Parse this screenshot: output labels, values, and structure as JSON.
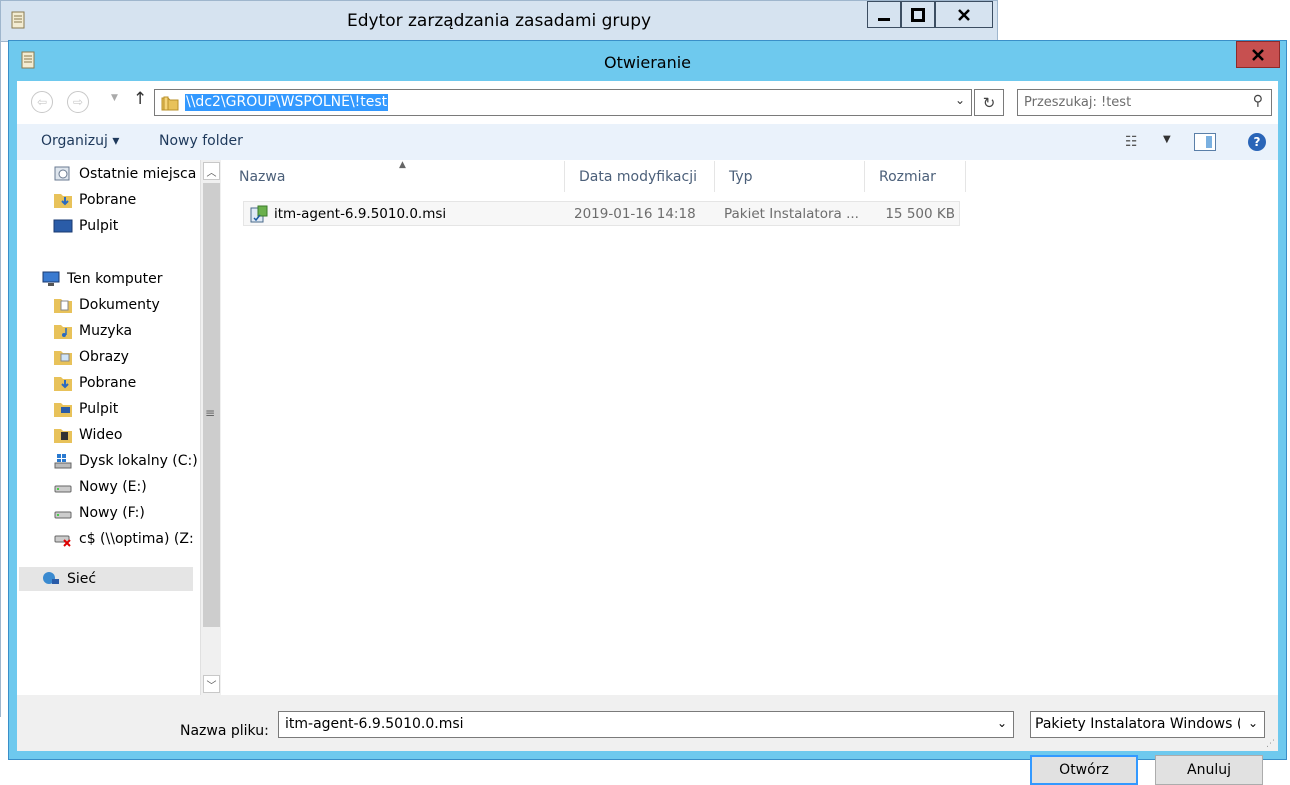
{
  "bg_window": {
    "title": "Edytor zarządzania zasadami grupy",
    "minimize": "▁",
    "maximize": "□",
    "close": "✕"
  },
  "dialog": {
    "title": "Otwieranie",
    "close": "✕"
  },
  "address": {
    "path": "\\\\dc2\\GROUP\\WSPÓLNE\\!test",
    "search_placeholder": "Przeszukaj: !test"
  },
  "toolbar": {
    "organize": "Organizuj ▾",
    "new_folder": "Nowy folder"
  },
  "nav": {
    "items": [
      {
        "label": "Ostatnie miejsca",
        "icon": "recent-places-icon"
      },
      {
        "label": "Pobrane",
        "icon": "downloads-folder-icon"
      },
      {
        "label": "Pulpit",
        "icon": "desktop-icon"
      },
      {
        "label": "Ten komputer",
        "icon": "computer-icon"
      },
      {
        "label": "Dokumenty",
        "icon": "documents-folder-icon"
      },
      {
        "label": "Muzyka",
        "icon": "music-folder-icon"
      },
      {
        "label": "Obrazy",
        "icon": "pictures-folder-icon"
      },
      {
        "label": "Pobrane",
        "icon": "downloads-folder-icon"
      },
      {
        "label": "Pulpit",
        "icon": "desktop-folder-icon"
      },
      {
        "label": "Wideo",
        "icon": "video-folder-icon"
      },
      {
        "label": "Dysk lokalny (C:)",
        "icon": "local-disk-icon"
      },
      {
        "label": "Nowy (E:)",
        "icon": "drive-icon"
      },
      {
        "label": "Nowy (F:)",
        "icon": "drive-icon"
      },
      {
        "label": "c$ (\\\\optima) (Z:",
        "icon": "disconnected-network-drive-icon"
      },
      {
        "label": "Sieć",
        "icon": "network-icon"
      }
    ]
  },
  "columns": {
    "name": "Nazwa",
    "date": "Data modyfikacji",
    "type": "Typ",
    "size": "Rozmiar"
  },
  "files": [
    {
      "name": "itm-agent-6.9.5010.0.msi",
      "date": "2019-01-16 14:18",
      "type": "Pakiet Instalatora ...",
      "size": "15 500 KB"
    }
  ],
  "bottom": {
    "filename_label": "Nazwa pliku:",
    "filename_value": "itm-agent-6.9.5010.0.msi",
    "filetype": "Pakiety Instalatora Windows (*.",
    "open": "Otwórz",
    "cancel": "Anuluj"
  }
}
